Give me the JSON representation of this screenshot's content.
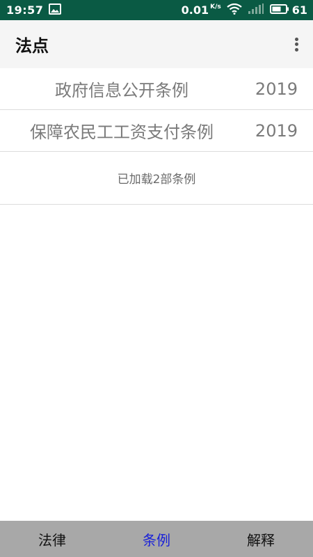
{
  "status_bar": {
    "time": "19:57",
    "speed": "0.01",
    "speed_unit": "K/s",
    "battery": "61",
    "icons": [
      "image-icon",
      "wifi-icon",
      "signal-icon",
      "battery-icon"
    ],
    "bg_color": "#0a5a44"
  },
  "app_bar": {
    "title": "法点",
    "menu_icon": "more-vert-icon"
  },
  "list": {
    "items": [
      {
        "title": "政府信息公开条例",
        "year": "2019"
      },
      {
        "title": "保障农民工工资支付条例",
        "year": "2019"
      }
    ],
    "load_status": "已加载2部条例"
  },
  "bottom_nav": {
    "tabs": [
      {
        "label": "法律",
        "active": false
      },
      {
        "label": "条例",
        "active": true
      },
      {
        "label": "解释",
        "active": false
      }
    ],
    "active_color": "#1a22d8",
    "bg_color": "#a8a8a8"
  }
}
